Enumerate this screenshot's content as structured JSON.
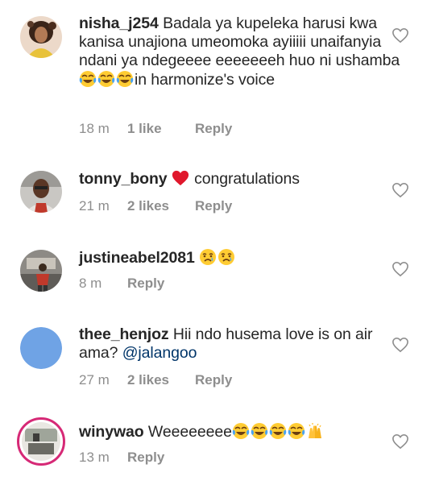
{
  "comments": [
    {
      "username": "nisha_j254",
      "text": "Badala ya kupeleka harusi kwa kanisa unajiona umeomoka ayiiiii unaifanyia ndani ya ndegeeee eeeeeeeh huo ni ushamba",
      "text_after_emoji": "in harmonize's voice",
      "emojis": [
        "tears-of-joy",
        "tears-of-joy",
        "tears-of-joy"
      ],
      "time": "18 m",
      "likes": "1 like",
      "reply": "Reply"
    },
    {
      "username": "tonny_bony",
      "emojis": [
        "red-heart"
      ],
      "text": "congratulations",
      "time": "21 m",
      "likes": "2 likes",
      "reply": "Reply"
    },
    {
      "username": "justineabel2081",
      "emojis": [
        "crying-face",
        "crying-face"
      ],
      "text": "",
      "time": "8 m",
      "likes": "",
      "reply": "Reply"
    },
    {
      "username": "thee_henjoz",
      "text": "Hii ndo husema love is on air ama?",
      "mention": "@jalangoo",
      "time": "27 m",
      "likes": "2 likes",
      "reply": "Reply"
    },
    {
      "username": "winywao",
      "text": "Weeeeeeee",
      "emojis": [
        "tears-of-joy",
        "tears-of-joy",
        "tears-of-joy",
        "tears-of-joy",
        "raising-hands"
      ],
      "time": "13 m",
      "likes": "",
      "reply": "Reply"
    }
  ],
  "colors": {
    "text": "#262626",
    "meta": "#8e8e8e",
    "mention": "#003569",
    "story_ring": "#d62976",
    "placeholder_avatar": "#6fa3e5"
  }
}
